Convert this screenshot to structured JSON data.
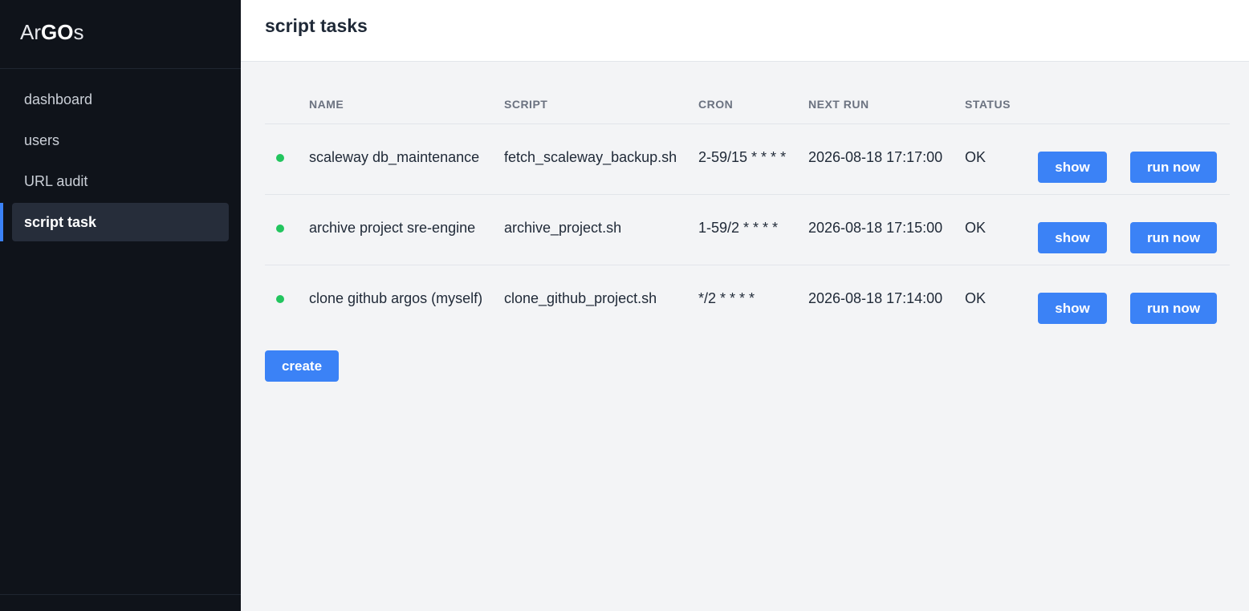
{
  "sidebar": {
    "brand": {
      "prefix": "Ar",
      "bold": "GO",
      "suffix": "s"
    },
    "items": [
      {
        "label": "dashboard",
        "active": false
      },
      {
        "label": "users",
        "active": false
      },
      {
        "label": "URL audit",
        "active": false
      },
      {
        "label": "script task",
        "active": true
      }
    ]
  },
  "header": {
    "title": "script tasks"
  },
  "table": {
    "columns": [
      "NAME",
      "SCRIPT",
      "CRON",
      "NEXT RUN",
      "STATUS"
    ],
    "rows": [
      {
        "name": "scaleway db_maintenance",
        "script": "fetch_scaleway_backup.sh",
        "cron": "2-59/15 * * * *",
        "next_run": "2026-08-18 17:17:00",
        "status": "OK"
      },
      {
        "name": "archive project sre-engine",
        "script": "archive_project.sh",
        "cron": "1-59/2 * * * *",
        "next_run": "2026-08-18 17:15:00",
        "status": "OK"
      },
      {
        "name": "clone github argos (myself)",
        "script": "clone_github_project.sh",
        "cron": "*/2 * * * *",
        "next_run": "2026-08-18 17:14:00",
        "status": "OK"
      }
    ],
    "show_label": "show",
    "run_label": "run now"
  },
  "create_label": "create",
  "colors": {
    "accent": "#3b82f6",
    "status_ok": "#22c55e",
    "sidebar_bg": "#0f131a"
  }
}
